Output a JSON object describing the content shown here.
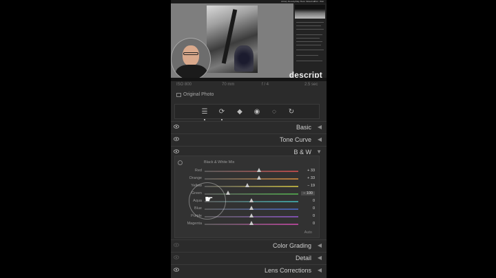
{
  "overlay": {
    "brand": "descript"
  },
  "thumbnail": {
    "menu": [
      "Library",
      "Develop",
      "Map",
      "Book",
      "Slideshow",
      "Print",
      "Web"
    ]
  },
  "panel": {
    "info_row": [
      "ISO 800",
      "70 mm",
      "f / 4",
      "2.5 sec"
    ],
    "original_photo": "Original Photo",
    "tools": [
      "sliders-icon",
      "crop-icon",
      "eraser-icon",
      "red-eye-icon",
      "masking-icon",
      "versions-icon"
    ],
    "sections": {
      "basic": "Basic",
      "tone_curve": "Tone Curve",
      "bw": "B & W",
      "color_grading": "Color Grading",
      "detail": "Detail",
      "lens_corrections": "Lens Corrections"
    },
    "bw_mix": {
      "title": "Black & White Mix",
      "auto": "Auto",
      "sliders": [
        {
          "label": "Red",
          "value": "+ 33",
          "level": 33
        },
        {
          "label": "Orange",
          "value": "+ 33",
          "level": 33
        },
        {
          "label": "Yellow",
          "value": "− 19",
          "level": -19
        },
        {
          "label": "Green",
          "value": "− 100",
          "level": -100
        },
        {
          "label": "Aqua",
          "value": "0",
          "level": 0
        },
        {
          "label": "Blue",
          "value": "0",
          "level": 0
        },
        {
          "label": "Purple",
          "value": "0",
          "level": 0
        },
        {
          "label": "Magenta",
          "value": "0",
          "level": 0
        }
      ]
    }
  }
}
